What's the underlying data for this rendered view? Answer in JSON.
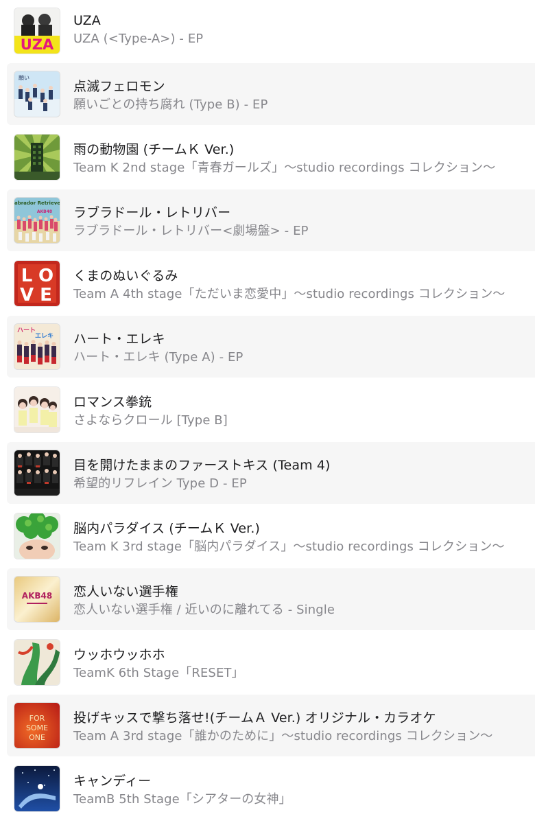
{
  "songs": [
    {
      "title": "UZA",
      "album": "UZA (<Type-A>) - EP",
      "artwork": "uza-cover-art"
    },
    {
      "title": "点滅フェロモン",
      "album": "願いごとの持ち腐れ (Type B) - EP",
      "artwork": "negaigoto-cover-art"
    },
    {
      "title": "雨の動物園 (チームＫ Ver.)",
      "album": "Team K 2nd stage「青春ガールズ」〜studio recordings コレクション〜",
      "artwork": "team-k-2nd-stage-cover-art"
    },
    {
      "title": "ラブラドール・レトリバー",
      "album": "ラブラドール・レトリバー<劇場盤> - EP",
      "artwork": "labrador-retriever-cover-art"
    },
    {
      "title": "くまのぬいぐるみ",
      "album": "Team A 4th stage「ただいま恋愛中」〜studio recordings コレクション〜",
      "artwork": "team-a-4th-stage-cover-art"
    },
    {
      "title": "ハート・エレキ",
      "album": "ハート・エレキ (Type A) - EP",
      "artwork": "heart-ereki-cover-art"
    },
    {
      "title": "ロマンス拳銃",
      "album": "さよならクロール [Type B]",
      "artwork": "sayonara-crawl-cover-art"
    },
    {
      "title": "目を開けたままのファーストキス (Team 4)",
      "album": "希望的リフレイン Type D - EP",
      "artwork": "kibouteki-refrain-cover-art"
    },
    {
      "title": "脳内パラダイス (チームＫ Ver.)",
      "album": "Team K 3rd stage「脳内パラダイス」〜studio recordings コレクション〜",
      "artwork": "team-k-3rd-stage-cover-art"
    },
    {
      "title": "恋人いない選手権",
      "album": "恋人いない選手権 / 近いのに離れてる - Single",
      "artwork": "koibito-inai-cover-art"
    },
    {
      "title": "ウッホウッホホ",
      "album": "TeamK 6th Stage「RESET」",
      "artwork": "teamk-reset-cover-art"
    },
    {
      "title": "投げキッスで撃ち落せ!(チームＡ Ver.) オリジナル・カラオケ",
      "album": "Team A 3rd stage「誰かのために」〜studio recordings コレクション〜",
      "artwork": "team-a-3rd-stage-cover-art"
    },
    {
      "title": "キャンディー",
      "album": "TeamB 5th Stage「シアターの女神」",
      "artwork": "teamb-5th-stage-cover-art"
    }
  ],
  "artwork_text": {
    "uza": "UZA",
    "love": "LOVE",
    "akb": "AKB48",
    "labrador": "Labrador Retriever",
    "for_someone": "FOR SOME ONE"
  }
}
